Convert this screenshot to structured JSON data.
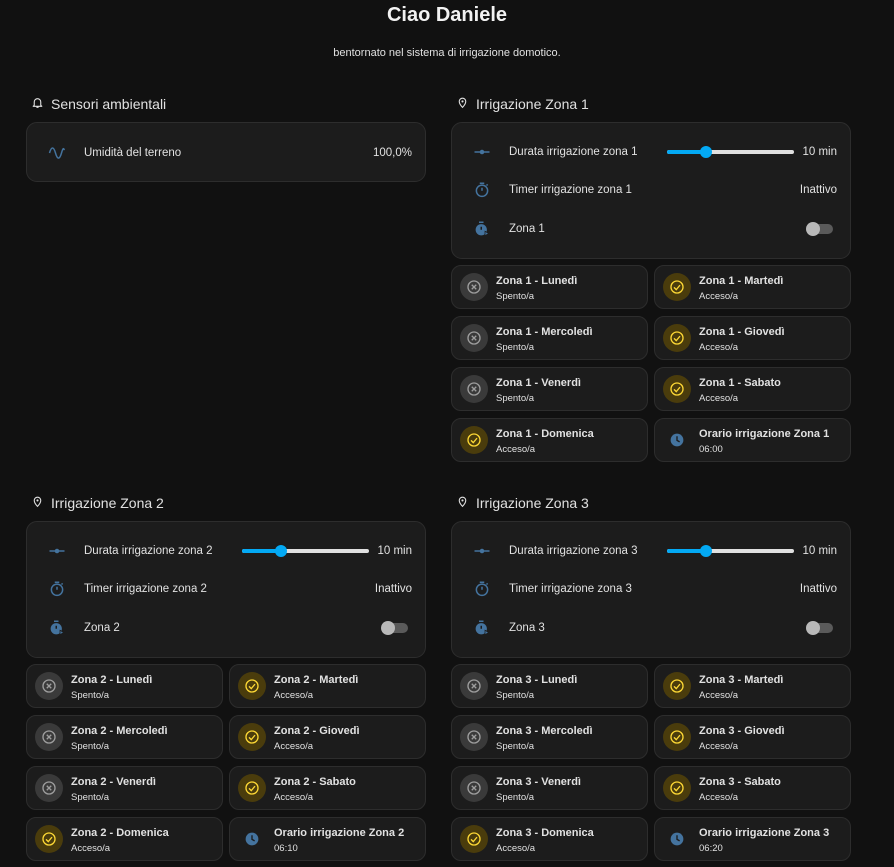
{
  "header": {
    "title": "Ciao Daniele",
    "subtitle": "bentornato nel sistema di irrigazione domotico."
  },
  "colors": {
    "background": "#111111",
    "card": "#1c1c1c",
    "accent": "#03a9f4",
    "on_yellow": "#fdd835",
    "icon_blue": "#44739e"
  },
  "sensors": {
    "title": "Sensori ambientali",
    "icon": "bell-icon",
    "humidity": {
      "icon": "sine-wave-icon",
      "label": "Umidità del terreno",
      "value": "100,0%"
    }
  },
  "zone1": {
    "title": "Irrigazione Zona 1",
    "icon": "map-pin-icon",
    "duration": {
      "label": "Durata irrigazione zona 1",
      "value": "10 min",
      "level": 0.31
    },
    "timer": {
      "label": "Timer irrigazione zona 1",
      "value": "Inattivo"
    },
    "switch": {
      "label": "Zona 1",
      "on": false
    },
    "days": [
      {
        "name": "Zona 1 - Lunedì",
        "state": "Spento/a",
        "on": false
      },
      {
        "name": "Zona 1 - Martedì",
        "state": "Acceso/a",
        "on": true
      },
      {
        "name": "Zona 1 - Mercoledì",
        "state": "Spento/a",
        "on": false
      },
      {
        "name": "Zona 1 - Giovedì",
        "state": "Acceso/a",
        "on": true
      },
      {
        "name": "Zona 1 - Venerdì",
        "state": "Spento/a",
        "on": false
      },
      {
        "name": "Zona 1 - Sabato",
        "state": "Acceso/a",
        "on": true
      },
      {
        "name": "Zona 1 - Domenica",
        "state": "Acceso/a",
        "on": true
      }
    ],
    "schedule": {
      "name": "Orario irrigazione Zona 1",
      "time": "06:00"
    }
  },
  "zone2": {
    "title": "Irrigazione Zona 2",
    "icon": "map-pin-icon",
    "duration": {
      "label": "Durata irrigazione zona 2",
      "value": "10 min",
      "level": 0.31
    },
    "timer": {
      "label": "Timer irrigazione zona 2",
      "value": "Inattivo"
    },
    "switch": {
      "label": "Zona 2",
      "on": false
    },
    "days": [
      {
        "name": "Zona 2 - Lunedì",
        "state": "Spento/a",
        "on": false
      },
      {
        "name": "Zona 2 - Martedì",
        "state": "Acceso/a",
        "on": true
      },
      {
        "name": "Zona 2 - Mercoledì",
        "state": "Spento/a",
        "on": false
      },
      {
        "name": "Zona 2 - Giovedì",
        "state": "Acceso/a",
        "on": true
      },
      {
        "name": "Zona 2 - Venerdì",
        "state": "Spento/a",
        "on": false
      },
      {
        "name": "Zona 2 - Sabato",
        "state": "Acceso/a",
        "on": true
      },
      {
        "name": "Zona 2 - Domenica",
        "state": "Acceso/a",
        "on": true
      }
    ],
    "schedule": {
      "name": "Orario irrigazione Zona 2",
      "time": "06:10"
    }
  },
  "zone3": {
    "title": "Irrigazione Zona 3",
    "icon": "map-pin-icon",
    "duration": {
      "label": "Durata irrigazione zona 3",
      "value": "10 min",
      "level": 0.31
    },
    "timer": {
      "label": "Timer irrigazione zona 3",
      "value": "Inattivo"
    },
    "switch": {
      "label": "Zona 3",
      "on": false
    },
    "days": [
      {
        "name": "Zona 3 - Lunedì",
        "state": "Spento/a",
        "on": false
      },
      {
        "name": "Zona 3 - Martedì",
        "state": "Acceso/a",
        "on": true
      },
      {
        "name": "Zona 3 - Mercoledì",
        "state": "Spento/a",
        "on": false
      },
      {
        "name": "Zona 3 - Giovedì",
        "state": "Acceso/a",
        "on": true
      },
      {
        "name": "Zona 3 - Venerdì",
        "state": "Spento/a",
        "on": false
      },
      {
        "name": "Zona 3 - Sabato",
        "state": "Acceso/a",
        "on": true
      },
      {
        "name": "Zona 3 - Domenica",
        "state": "Acceso/a",
        "on": true
      }
    ],
    "schedule": {
      "name": "Orario irrigazione Zona 3",
      "time": "06:20"
    }
  }
}
